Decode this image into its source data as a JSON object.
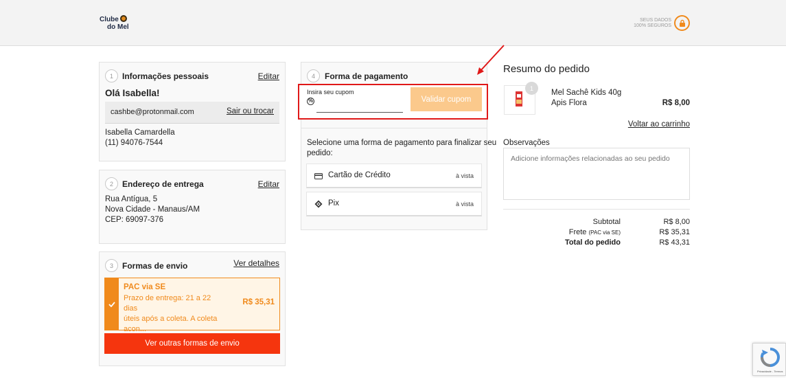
{
  "header": {
    "logo_line1": "Clube",
    "logo_line2": "do Mel",
    "secure_line1": "SEUS DADOS",
    "secure_line2": "100% SEGUROS"
  },
  "personal": {
    "step": "1",
    "title": "Informações pessoais",
    "edit": "Editar",
    "greeting": "Olá Isabella!",
    "email": "cashbe@protonmail.com",
    "logout": "Sair ou trocar",
    "name": "Isabella Camardella",
    "phone": "(11) 94076-7544"
  },
  "address": {
    "step": "2",
    "title": "Endereço de entrega",
    "edit": "Editar",
    "line1": "Rua Antígua, 5",
    "line2": "Nova Cidade - Manaus/AM",
    "line3": "CEP: 69097-376"
  },
  "shipping": {
    "step": "3",
    "title": "Formas de envio",
    "details": "Ver detalhes",
    "option_name": "PAC via SE",
    "option_desc_1": "Prazo de entrega: 21 a 22 dias",
    "option_desc_2": "úteis após a coleta. A coleta",
    "option_desc_3": "acon...",
    "option_price": "R$ 35,31",
    "other_button": "Ver outras formas de envio"
  },
  "payment": {
    "step": "4",
    "title": "Forma de pagamento",
    "coupon_label": "Insira seu cupom",
    "coupon_value": "",
    "coupon_button": "Validar cupom",
    "instructions_1": "Selecione uma forma de pagamento para finalizar seu",
    "instructions_2": "pedido:",
    "methods": [
      {
        "name": "Cartão de Crédito",
        "note": "à vista"
      },
      {
        "name": "Pix",
        "note": "à vista"
      }
    ]
  },
  "summary": {
    "title": "Resumo do pedido",
    "item_qty": "1",
    "item_name_1": "Mel Sachê Kids 40g",
    "item_name_2": "Apis Flora",
    "item_price": "R$ 8,00",
    "back_to_cart": "Voltar ao carrinho",
    "notes_label": "Observações",
    "notes_placeholder": "Adicione informações relacionadas ao seu pedido",
    "subtotal_label": "Subtotal",
    "subtotal_value": "R$ 8,00",
    "shipping_label": "Frete",
    "shipping_method": "(PAC via SE)",
    "shipping_value": "R$ 35,31",
    "total_label": "Total do pedido",
    "total_value": "R$ 43,31"
  },
  "recaptcha": {
    "text": "Privacidade - Termos"
  },
  "colors": {
    "accent_orange": "#f08a1c",
    "button_red": "#f5350e",
    "coupon_button": "#fbc98c",
    "highlight_red": "#e01818"
  }
}
